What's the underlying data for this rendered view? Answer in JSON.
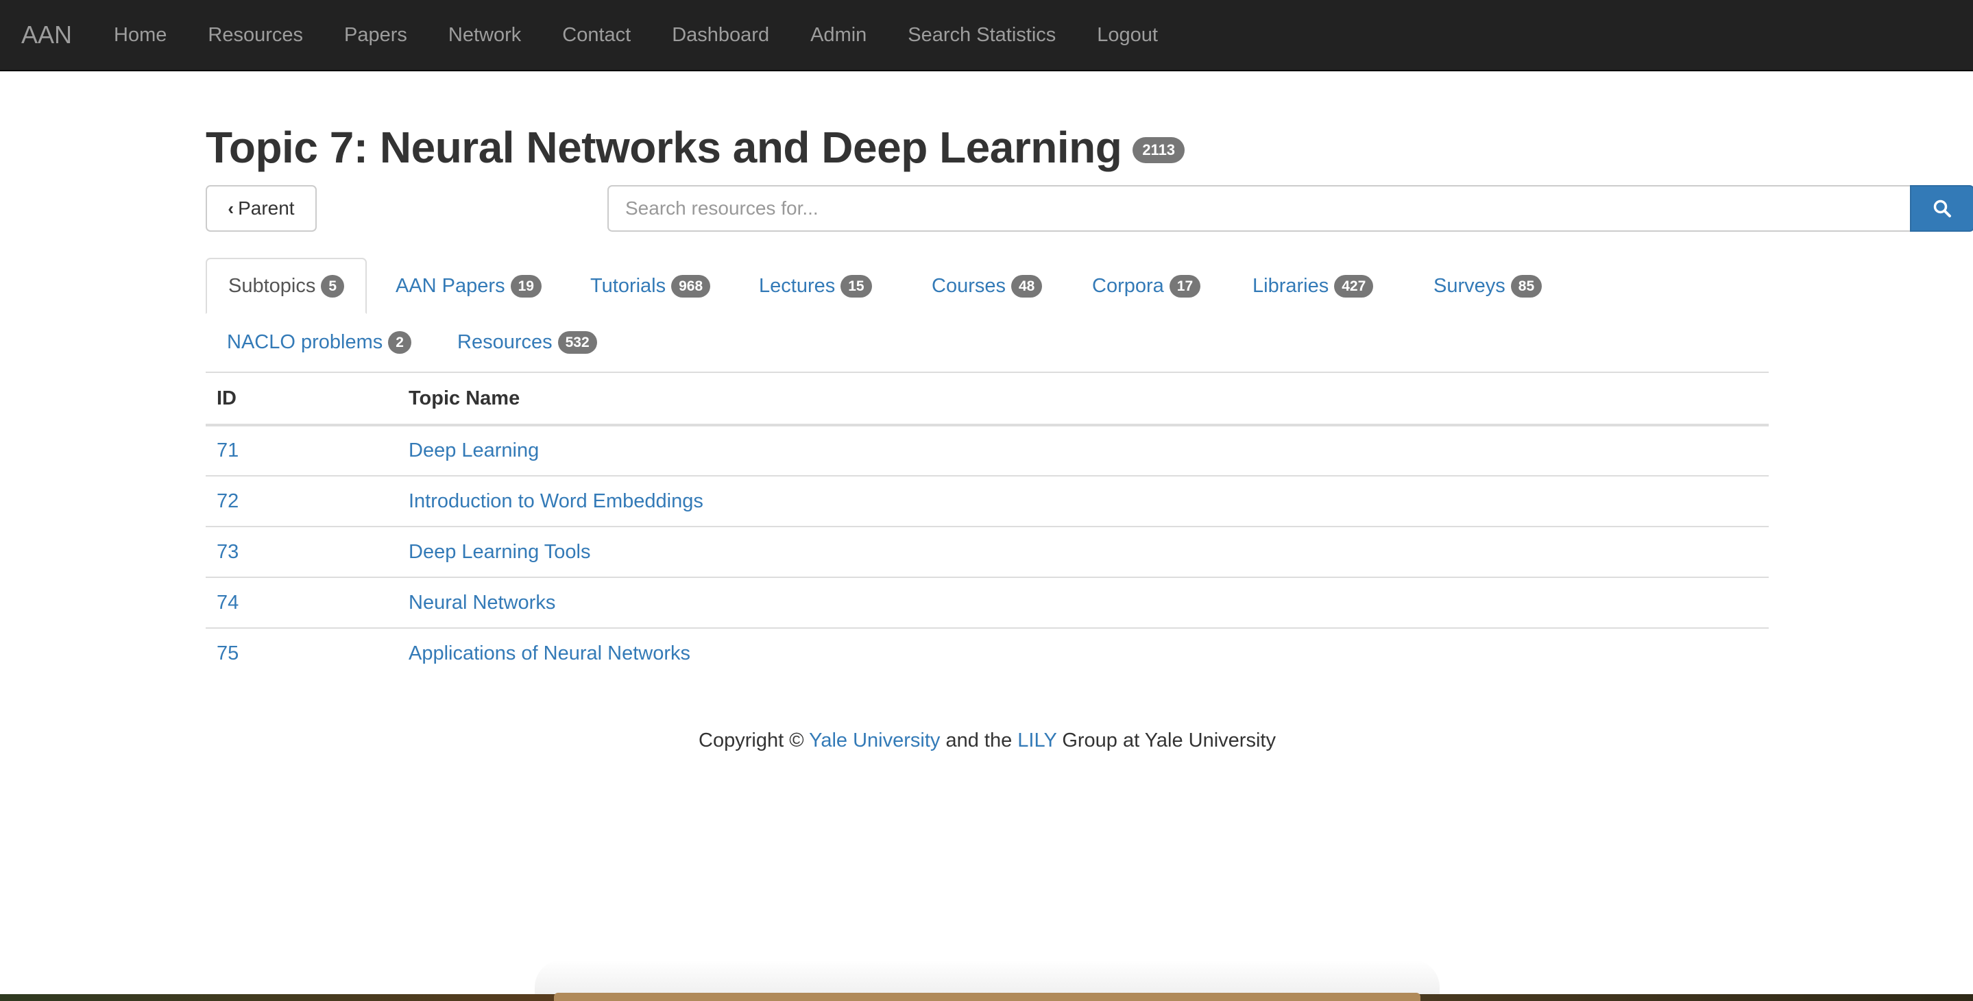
{
  "navbar": {
    "brand": "AAN",
    "items": [
      "Home",
      "Resources",
      "Papers",
      "Network",
      "Contact",
      "Dashboard",
      "Admin",
      "Search Statistics",
      "Logout"
    ]
  },
  "page": {
    "title": "Topic 7: Neural Networks and Deep Learning",
    "count": "2113",
    "parent_label": "Parent"
  },
  "search": {
    "placeholder": "Search resources for..."
  },
  "tabs": [
    {
      "label": "Subtopics",
      "count": "5"
    },
    {
      "label": "AAN Papers",
      "count": "19"
    },
    {
      "label": "Tutorials",
      "count": "968"
    },
    {
      "label": "Lectures",
      "count": "15"
    },
    {
      "label": "Courses",
      "count": "48"
    },
    {
      "label": "Corpora",
      "count": "17"
    },
    {
      "label": "Libraries",
      "count": "427"
    },
    {
      "label": "Surveys",
      "count": "85"
    },
    {
      "label": "NACLO problems",
      "count": "2"
    },
    {
      "label": "Resources",
      "count": "532"
    }
  ],
  "table": {
    "headers": [
      "ID",
      "Topic Name"
    ],
    "rows": [
      {
        "id": "71",
        "name": "Deep Learning"
      },
      {
        "id": "72",
        "name": "Introduction to Word Embeddings"
      },
      {
        "id": "73",
        "name": "Deep Learning Tools"
      },
      {
        "id": "74",
        "name": "Neural Networks"
      },
      {
        "id": "75",
        "name": "Applications of Neural Networks"
      }
    ]
  },
  "footer": {
    "prefix": "Copyright ©",
    "link1": "Yale University",
    "middle": "and the",
    "link2": "LILY",
    "suffix": "Group at Yale University"
  },
  "colors": {
    "navbar_bg": "#222222",
    "link": "#337ab7",
    "badge": "#777777",
    "primary_button": "#337ab7"
  }
}
